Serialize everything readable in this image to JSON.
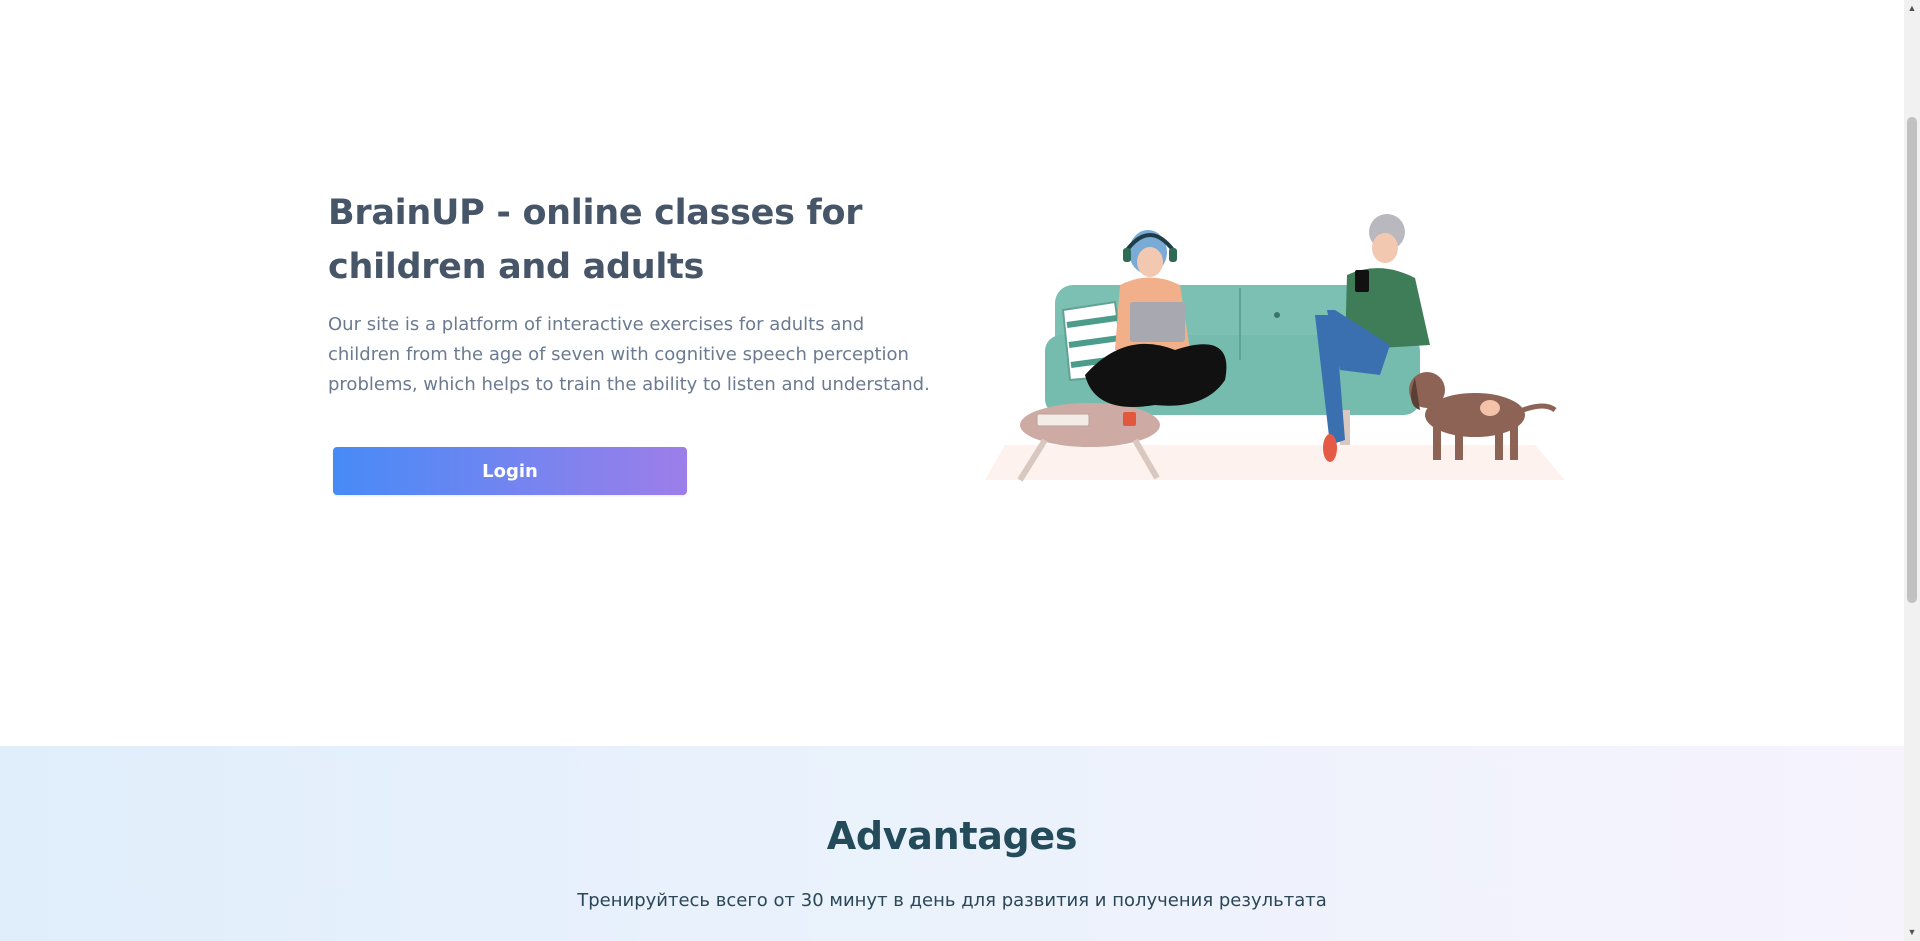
{
  "hero": {
    "title": "BrainUP - online classes for children and adults",
    "description": "Our site is a platform of interactive exercises for adults and children from the age of seven with cognitive speech perception problems, which helps to train the ability to listen and understand.",
    "login_label": "Login"
  },
  "advantages": {
    "title": "Advantages",
    "subtitle": "Тренируйтесь всего от 30 минут в день для развития и получения результата"
  },
  "icons": {
    "scroll_up": "▲",
    "scroll_down": "▼"
  },
  "colors": {
    "button_gradient_start": "#478bf7",
    "button_gradient_end": "#9d7ee9",
    "title_text": "#475569",
    "advantages_title": "#234b5a",
    "sofa": "#7bc0b2"
  }
}
